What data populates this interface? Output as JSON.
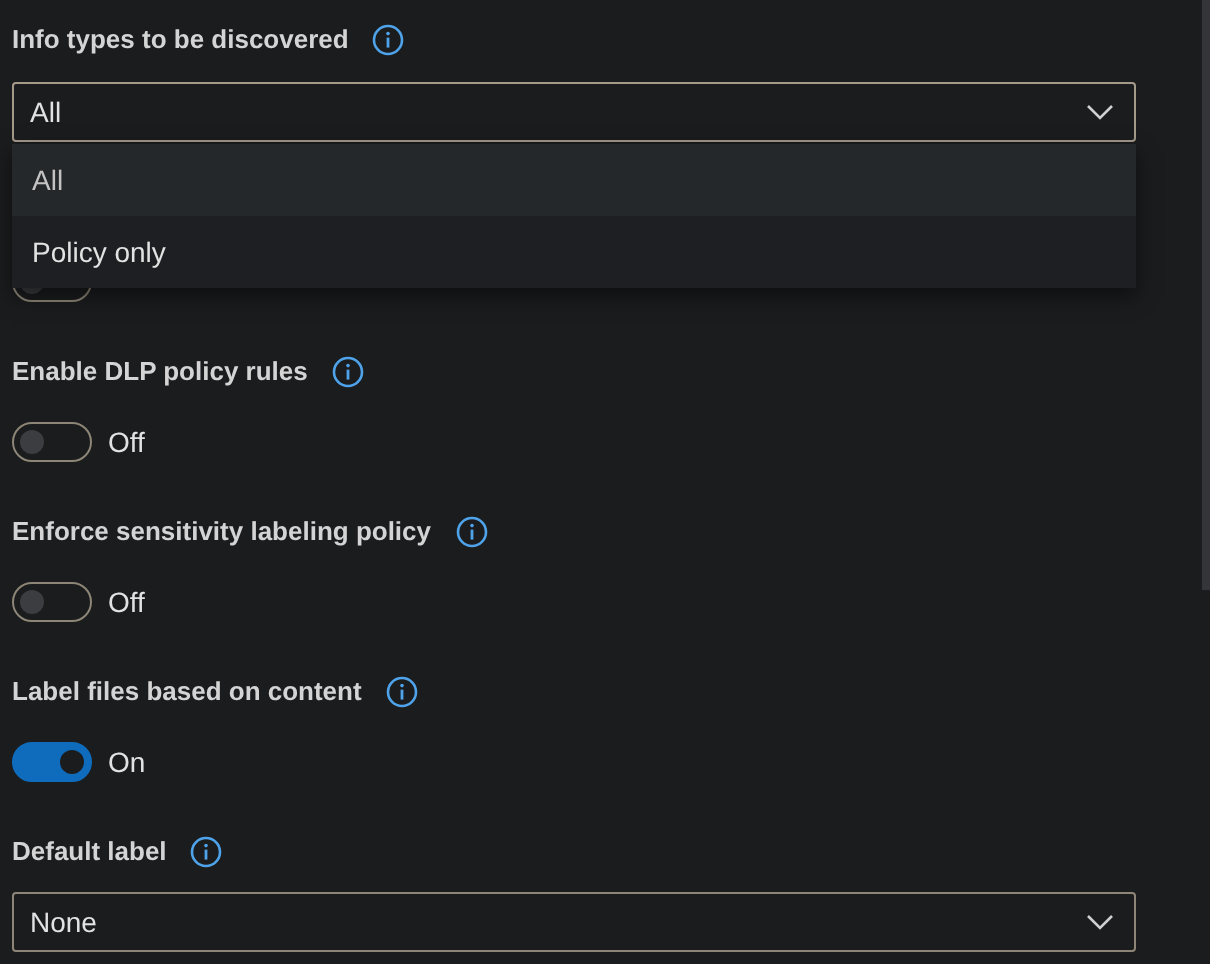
{
  "fields": [
    {
      "kind": "dropdown",
      "label": "Info types to be discovered",
      "value": "All",
      "expanded": true,
      "options": [
        {
          "label": "All",
          "selected": true
        },
        {
          "label": "Policy only",
          "selected": false
        }
      ]
    },
    {
      "kind": "toggle",
      "on": false
    },
    {
      "kind": "toggle",
      "label": "Enable DLP policy rules",
      "on": false,
      "state_text": "Off"
    },
    {
      "kind": "toggle",
      "label": "Enforce sensitivity labeling policy",
      "on": false,
      "state_text": "Off"
    },
    {
      "kind": "toggle",
      "label": "Label files based on content",
      "on": true,
      "state_text": "On"
    },
    {
      "kind": "dropdown",
      "label": "Default label",
      "value": "None"
    }
  ]
}
